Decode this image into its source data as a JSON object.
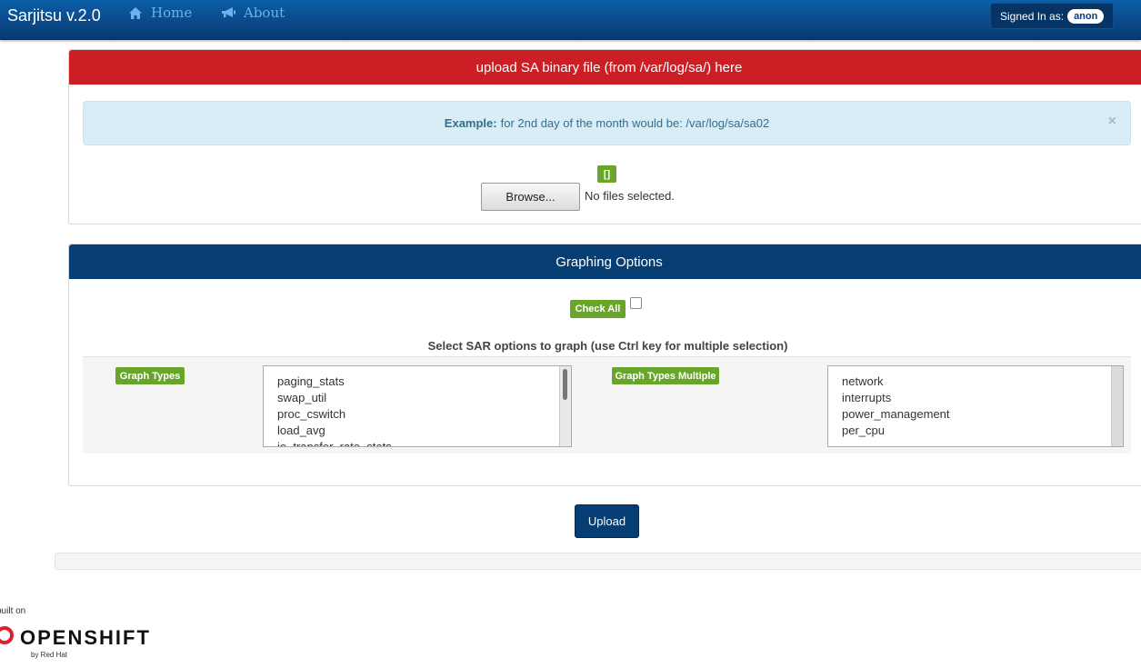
{
  "navbar": {
    "brand": "Sarjitsu v.2.0",
    "home_label": "Home",
    "about_label": "About",
    "signed_in_label": "Signed In as:",
    "user": "anon"
  },
  "upload_panel": {
    "heading": "upload SA binary file (from /var/log/sa/) here",
    "alert_bold": "Example:",
    "alert_text": "for 2nd day of the month would be: /var/log/sa/sa02",
    "alert_close": "×",
    "file_badge": "[]",
    "browse_label": "Browse...",
    "file_status": "No files selected."
  },
  "graph_panel": {
    "heading": "Graphing Options",
    "check_all_label": "Check All",
    "select_title": "Select SAR options to graph (use Ctrl key for multiple selection)",
    "graph_types_label": "Graph Types",
    "graph_types": [
      "paging_stats",
      "swap_util",
      "proc_cswitch",
      "load_avg",
      "io_transfer_rate_stats"
    ],
    "graph_types_multiple_label": "Graph Types Multiple",
    "graph_types_multiple": [
      "network",
      "interrupts",
      "power_management",
      "per_cpu"
    ]
  },
  "upload_button_label": "Upload",
  "footer": {
    "built_on": "built on",
    "logo_text": "OPENSHIFT",
    "by_red_hat": "by Red Hat"
  },
  "colors": {
    "navbar": "#0b4a8a",
    "upload_header": "#cc1e25",
    "graph_header": "#063e73",
    "green_badge": "#6aa52b",
    "alert_bg": "#d9edf7"
  }
}
